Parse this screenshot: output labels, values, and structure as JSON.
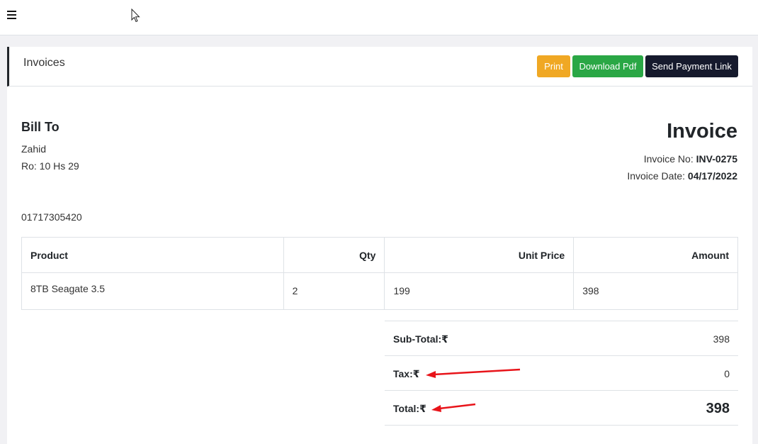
{
  "header": {
    "menu_icon": "hamburger-icon"
  },
  "card": {
    "title": "Invoices",
    "buttons": {
      "print": "Print",
      "download_pdf": "Download Pdf",
      "send_payment_link": "Send Payment Link"
    }
  },
  "bill_to": {
    "heading": "Bill To",
    "name": "Zahid",
    "address": "Ro: 10 Hs 29",
    "phone": "01717305420"
  },
  "invoice": {
    "heading": "Invoice",
    "no_label": "Invoice No:",
    "no_value": "INV-0275",
    "date_label": "Invoice Date:",
    "date_value": "04/17/2022"
  },
  "table": {
    "columns": [
      "Product",
      "Qty",
      "Unit Price",
      "Amount"
    ],
    "rows": [
      {
        "product": "8TB Seagate 3.5",
        "qty": "2",
        "unit_price": "199",
        "amount": "398"
      }
    ]
  },
  "totals": {
    "subtotal_label": "Sub-Total:₹",
    "subtotal_value": "398",
    "tax_label": "Tax:₹",
    "tax_value": "0",
    "total_label": "Total:₹",
    "total_value": "398"
  },
  "colors": {
    "print_button": "#f0a824",
    "pdf_button": "#2aa745",
    "link_button": "#161a2d",
    "annotation_arrow": "#e8141a"
  }
}
